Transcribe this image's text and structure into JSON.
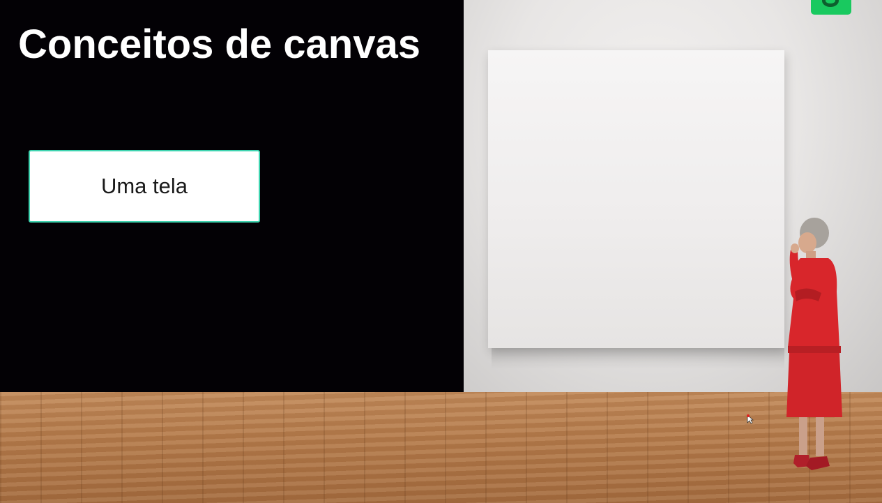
{
  "slide": {
    "title": "Conceitos de canvas",
    "box_label": "Uma tela"
  },
  "colors": {
    "panel_bg": "#030105",
    "title_text": "#ffffff",
    "box_border": "#3fd4b0",
    "logo_green": "#19c95f",
    "dress_red": "#d8262b"
  },
  "icons": {
    "logo": "brand-logo-icon",
    "cursor": "mouse-cursor-icon"
  }
}
